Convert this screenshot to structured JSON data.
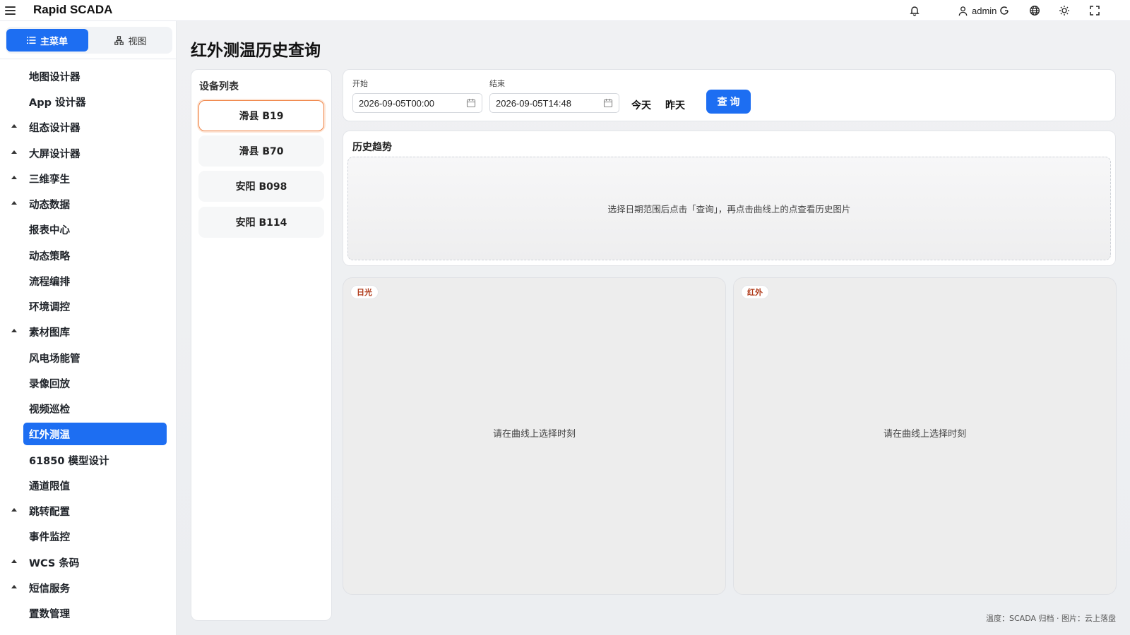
{
  "app": {
    "title": "Rapid SCADA"
  },
  "header": {
    "user_name": "admin"
  },
  "sidebar": {
    "tabs": [
      {
        "label": "主菜单",
        "icon": "list-icon"
      },
      {
        "label": "视图",
        "icon": "sitemap-icon"
      }
    ],
    "items": [
      {
        "label": "地图设计器",
        "caret": false,
        "active": false
      },
      {
        "label": "App 设计器",
        "caret": false,
        "active": false
      },
      {
        "label": "组态设计器",
        "caret": true,
        "active": false
      },
      {
        "label": "大屏设计器",
        "caret": true,
        "active": false
      },
      {
        "label": "三维孪生",
        "caret": true,
        "active": false
      },
      {
        "label": "动态数据",
        "caret": true,
        "active": false
      },
      {
        "label": "报表中心",
        "caret": false,
        "active": false
      },
      {
        "label": "动态策略",
        "caret": false,
        "active": false
      },
      {
        "label": "流程编排",
        "caret": false,
        "active": false
      },
      {
        "label": "环境调控",
        "caret": false,
        "active": false
      },
      {
        "label": "素材图库",
        "caret": true,
        "active": false
      },
      {
        "label": "风电场能管",
        "caret": false,
        "active": false
      },
      {
        "label": "录像回放",
        "caret": false,
        "active": false
      },
      {
        "label": "视频巡检",
        "caret": false,
        "active": false
      },
      {
        "label": "红外测温",
        "caret": false,
        "active": true
      },
      {
        "label": "61850 模型设计",
        "caret": false,
        "active": false
      },
      {
        "label": "通道限值",
        "caret": false,
        "active": false
      },
      {
        "label": "跳转配置",
        "caret": true,
        "active": false
      },
      {
        "label": "事件监控",
        "caret": false,
        "active": false
      },
      {
        "label": "WCS 条码",
        "caret": true,
        "active": false
      },
      {
        "label": "短信服务",
        "caret": true,
        "active": false
      },
      {
        "label": "置数管理",
        "caret": false,
        "active": false
      }
    ]
  },
  "page": {
    "title": "红外测温历史查询"
  },
  "devices": {
    "title": "设备列表",
    "items": [
      {
        "label": "滑县 B19",
        "active": true
      },
      {
        "label": "滑县 B70",
        "active": false
      },
      {
        "label": "安阳 B098",
        "active": false
      },
      {
        "label": "安阳 B114",
        "active": false
      }
    ]
  },
  "query": {
    "start_label": "开始",
    "start_value": "2026-09-05T00:00",
    "end_label": "结束",
    "end_value": "2026-09-05T14:48",
    "today": "今天",
    "yesterday": "昨天",
    "submit": "查询"
  },
  "trend": {
    "title": "历史趋势",
    "placeholder": "选择日期范围后点击「查询」，再点击曲线上的点查看历史图片"
  },
  "images": [
    {
      "tag": "日光",
      "hint": "请在曲线上选择时刻"
    },
    {
      "tag": "红外",
      "hint": "请在曲线上选择时刻"
    }
  ],
  "footer": {
    "note": "温度：SCADA 归档 · 图片：云上落盘"
  },
  "colors": {
    "accent": "#1d6ef2",
    "selected_border": "#f0874c",
    "tag_text": "#b03a1a"
  }
}
